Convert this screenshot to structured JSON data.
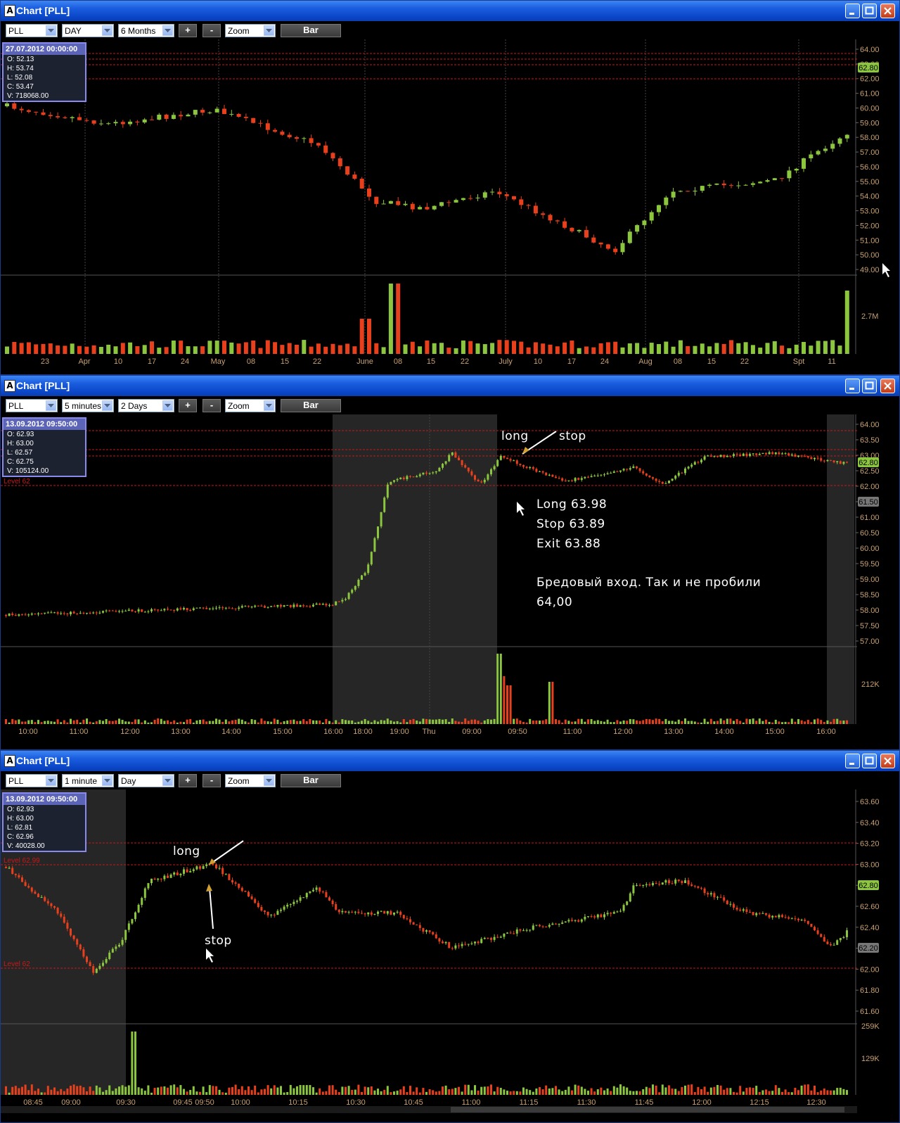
{
  "windows": [
    {
      "title": "Chart [PLL]",
      "app_icon": "A",
      "toolbar": {
        "symbol": "PLL",
        "interval": "DAY",
        "range": "6 Months",
        "plus": "+",
        "minus": "-",
        "zoom": "Zoom",
        "style": "Bar"
      },
      "info": {
        "header": "27.07.2012 00:00:00",
        "lines": [
          "O: 52.13",
          "H: 53.74",
          "L: 52.08",
          "C: 53.47",
          "V: 718068.00"
        ]
      },
      "y_ticks": [
        "64.00",
        "63.00",
        "62.00",
        "61.00",
        "60.00",
        "59.00",
        "58.00",
        "57.00",
        "56.00",
        "55.00",
        "54.00",
        "53.00",
        "52.00",
        "51.00",
        "50.00",
        "49.00"
      ],
      "price_tag": "62.80",
      "volume_label": "2.7M",
      "x_ticks": [
        "23",
        "Apr",
        "10",
        "17",
        "24",
        "May",
        "08",
        "15",
        "22",
        "June",
        "08",
        "15",
        "22",
        "July",
        "10",
        "17",
        "24",
        "Aug",
        "08",
        "15",
        "22",
        "Spt",
        "11"
      ]
    },
    {
      "title": "Chart [PLL]",
      "app_icon": "A",
      "toolbar": {
        "symbol": "PLL",
        "interval": "5 minutes",
        "range": "2 Days",
        "plus": "+",
        "minus": "-",
        "zoom": "Zoom",
        "style": "Bar"
      },
      "info": {
        "header": "13.09.2012 09:50:00",
        "lines": [
          "O: 62.93",
          "H: 63.00",
          "L: 62.57",
          "C: 62.75",
          "V: 105124.00"
        ]
      },
      "level_label": "Level 62",
      "y_ticks": [
        "64.00",
        "63.50",
        "63.00",
        "62.50",
        "62.00",
        "61.50",
        "61.00",
        "60.50",
        "60.00",
        "59.50",
        "59.00",
        "58.50",
        "58.00",
        "57.50",
        "57.00"
      ],
      "price_tag": "62.80",
      "level_tag": "61.50",
      "volume_label": "212K",
      "annotations": {
        "long": "long",
        "stop": "stop",
        "entry": "Long 63.98",
        "stop_price": "Stop 63.89",
        "exit": "Exit 63.88",
        "comment_1": "Бредовый вход. Так и не пробили",
        "comment_2": "64,00"
      },
      "x_ticks": [
        "10:00",
        "11:00",
        "12:00",
        "13:00",
        "14:00",
        "15:00",
        "16:00",
        "18:00",
        "19:00",
        "Thu",
        "09:00",
        "09:50",
        "11:00",
        "12:00",
        "13:00",
        "14:00",
        "15:00",
        "16:00"
      ]
    },
    {
      "title": "Chart [PLL]",
      "app_icon": "A",
      "toolbar": {
        "symbol": "PLL",
        "interval": "1 minute",
        "range": "Day",
        "plus": "+",
        "minus": "-",
        "zoom": "Zoom",
        "style": "Bar"
      },
      "info": {
        "header": "13.09.2012 09:50:00",
        "lines": [
          "O: 62.93",
          "H: 63.00",
          "L: 62.81",
          "C: 62.96",
          "V: 40028.00"
        ]
      },
      "level_label_1": "Level 62.99",
      "level_label_2": "Level 62",
      "y_ticks": [
        "63.60",
        "63.40",
        "63.20",
        "63.00",
        "62.80",
        "62.60",
        "62.40",
        "62.20",
        "62.00",
        "61.80",
        "61.60"
      ],
      "price_tag": "62.80",
      "level_tag": "62.20",
      "volume_ticks": [
        "259K",
        "129K"
      ],
      "annotations": {
        "long": "long",
        "stop": "stop"
      },
      "x_ticks": [
        "08:45",
        "09:00",
        "09:30",
        "09:45",
        "09:50",
        "10:00",
        "10:15",
        "10:30",
        "10:45",
        "11:00",
        "11:15",
        "11:30",
        "11:45",
        "12:00",
        "12:15",
        "12:30"
      ]
    }
  ],
  "colors": {
    "up": "#8cc63f",
    "down": "#e8401c",
    "level_line": "#c81818",
    "title_bar": "#0a46c8",
    "axis_text": "#c8a070",
    "price_tag": "#8cc63f"
  },
  "icons": [
    "minimize-icon",
    "maximize-icon",
    "close-icon",
    "dropdown-arrow-icon",
    "mouse-cursor-icon",
    "annotation-arrow-icon"
  ]
}
